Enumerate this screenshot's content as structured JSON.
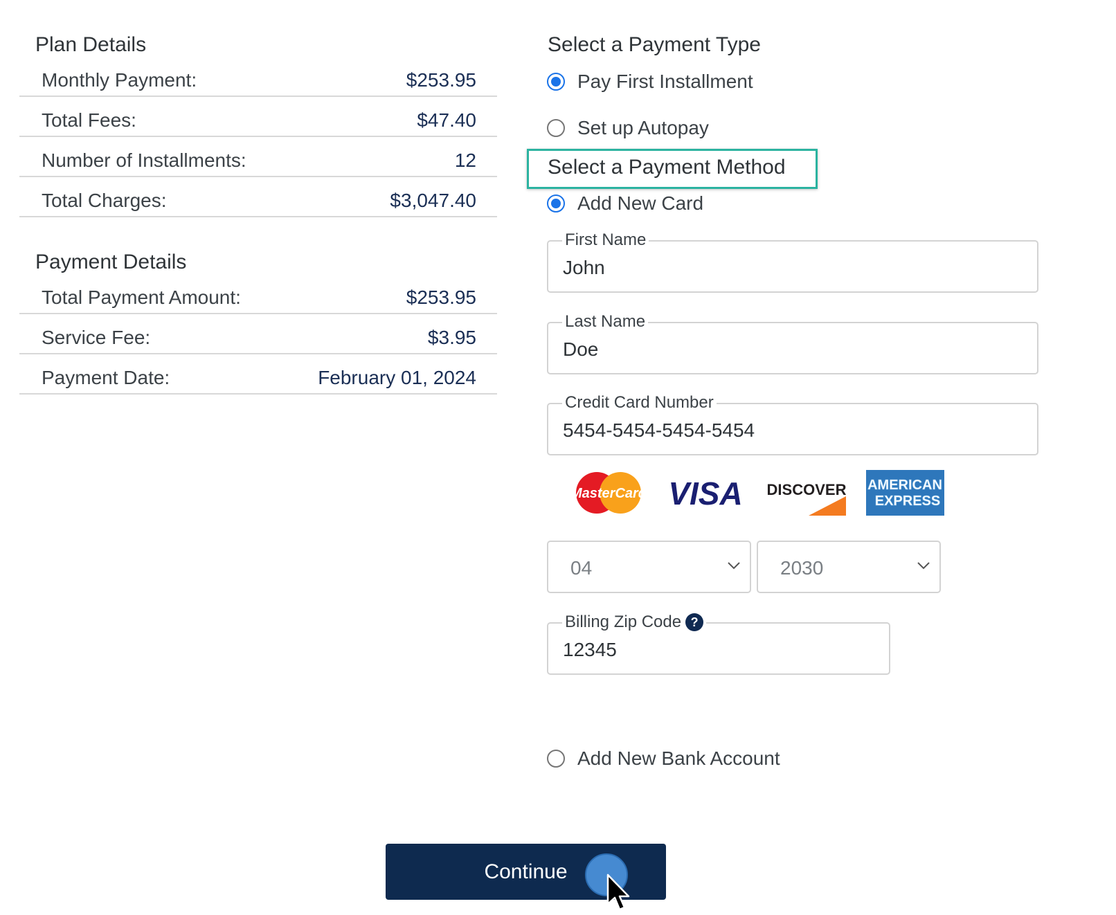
{
  "plan_details": {
    "title": "Plan Details",
    "rows": [
      {
        "label": "Monthly Payment:",
        "value": "$253.95"
      },
      {
        "label": "Total Fees:",
        "value": "$47.40"
      },
      {
        "label": "Number of Installments:",
        "value": "12"
      },
      {
        "label": "Total Charges:",
        "value": "$3,047.40"
      }
    ]
  },
  "payment_details": {
    "title": "Payment Details",
    "rows": [
      {
        "label": "Total Payment Amount:",
        "value": "$253.95"
      },
      {
        "label": "Service Fee:",
        "value": "$3.95"
      },
      {
        "label": "Payment Date:",
        "value": "February 01, 2024"
      }
    ]
  },
  "payment_type": {
    "title": "Select a Payment Type",
    "options": [
      {
        "label": "Pay First Installment",
        "selected": true
      },
      {
        "label": "Set up Autopay",
        "selected": false
      }
    ]
  },
  "payment_method": {
    "title": "Select a Payment Method",
    "add_card_label": "Add New Card",
    "add_card_selected": true,
    "add_bank_label": "Add New Bank Account",
    "add_bank_selected": false
  },
  "card_form": {
    "first_name": {
      "label": "First Name",
      "value": "John"
    },
    "last_name": {
      "label": "Last Name",
      "value": "Doe"
    },
    "card_number": {
      "label": "Credit Card Number",
      "value": "5454-5454-5454-5454"
    },
    "exp_month": "04",
    "exp_year": "2030",
    "zip": {
      "label": "Billing Zip Code",
      "value": "12345",
      "help_glyph": "?"
    }
  },
  "card_logos": {
    "mastercard": "MasterCard",
    "visa": "VISA",
    "discover": "DISCOVER",
    "amex_line1": "AMERICAN",
    "amex_line2": "EXPRESS"
  },
  "continue_label": "Continue",
  "colors": {
    "navy": "#0e2a4f",
    "value_text": "#1b2f55",
    "radio_blue": "#1a73e8",
    "highlight": "#2bb3a0"
  }
}
